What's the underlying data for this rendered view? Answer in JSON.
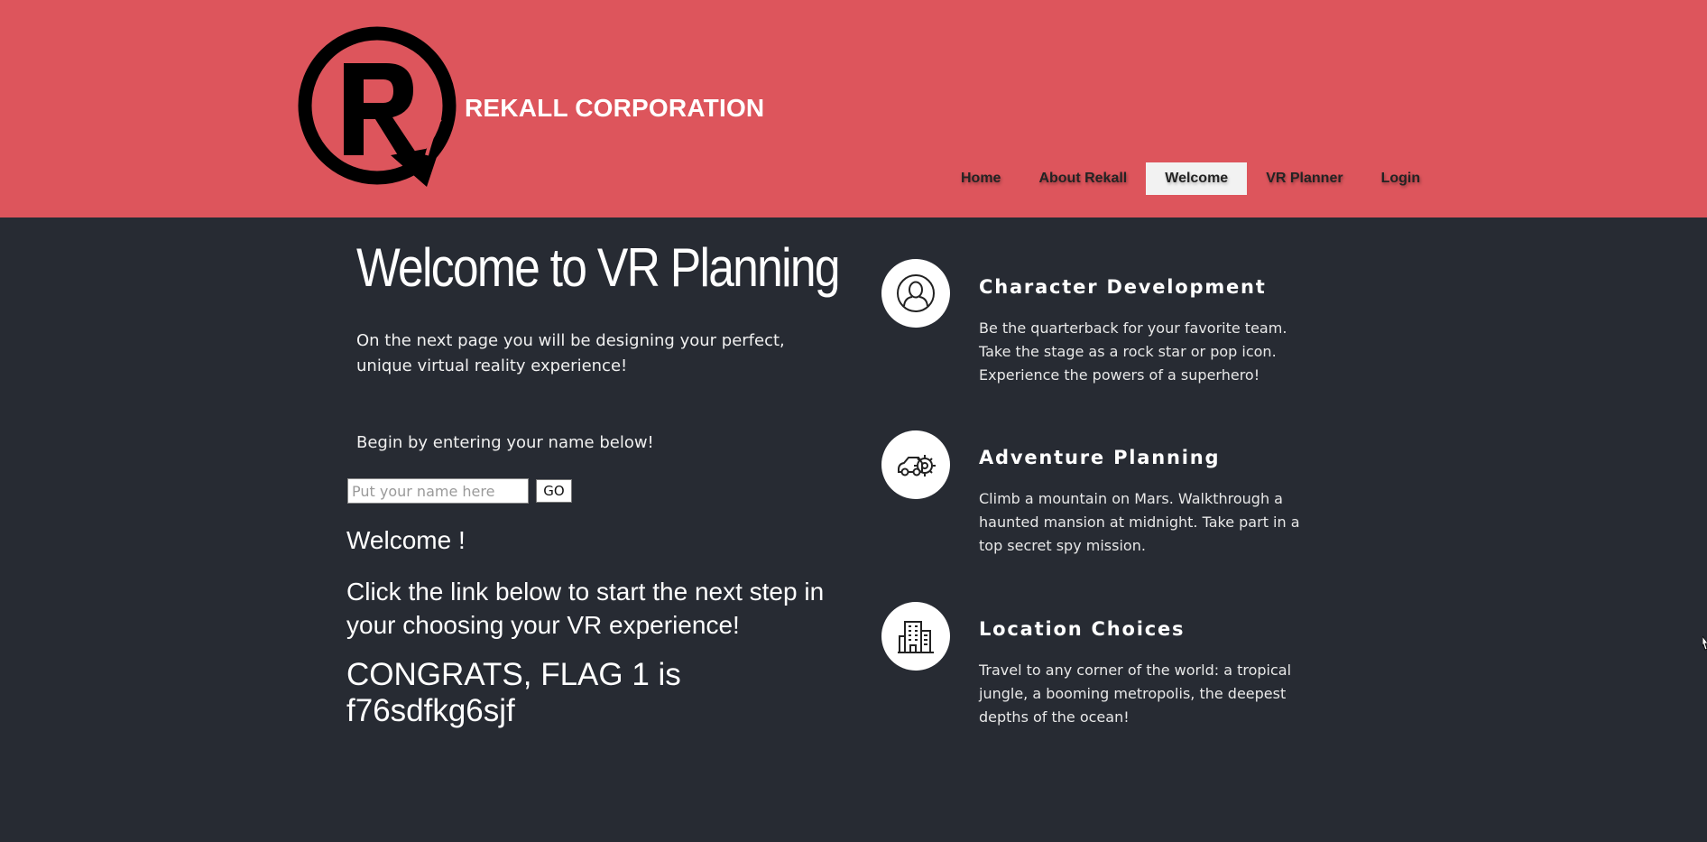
{
  "header": {
    "brand": "REKALL CORPORATION",
    "colors": {
      "background": "#dd555c",
      "page_background": "#272b33"
    },
    "nav": [
      {
        "label": "Home",
        "active": false
      },
      {
        "label": "About Rekall",
        "active": false
      },
      {
        "label": "Welcome",
        "active": true
      },
      {
        "label": "VR Planner",
        "active": false
      },
      {
        "label": "Login",
        "active": false
      }
    ]
  },
  "main": {
    "title": "Welcome to VR Planning",
    "intro": "On the next  page you will be designing your perfect, unique virtual reality experience!",
    "begin": "Begin by entering your name below!",
    "name_input": {
      "placeholder": "Put your name here",
      "value": ""
    },
    "go_label": "GO",
    "welcome_message": "Welcome !",
    "next_step": "Click the link below to start the next step in your choosing your VR experience!",
    "flag": "CONGRATS, FLAG 1 is f76sdfkg6sjf"
  },
  "features": [
    {
      "icon": "person-icon",
      "title": "Character Development",
      "text": "Be the quarterback for your favorite team. Take the stage as a rock star or pop icon. Experience the powers of a superhero!"
    },
    {
      "icon": "car-gear-icon",
      "title": "Adventure Planning",
      "text": "Climb a mountain on Mars. Walkthrough a haunted mansion at midnight. Take part in a top secret spy mission."
    },
    {
      "icon": "building-icon",
      "title": "Location Choices",
      "text": "Travel to any corner of the world: a tropical jungle, a booming metropolis, the deepest depths of the ocean!"
    }
  ]
}
